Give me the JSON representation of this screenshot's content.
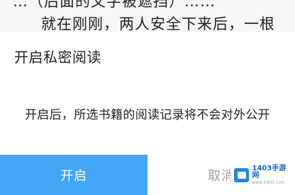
{
  "background": {
    "line_1": "…（后面的文字被遮挡）……",
    "line_2": "就在刚刚，两人安全下来后，一根"
  },
  "dialog": {
    "title": "开启私密阅读",
    "message": "开启后，所选书籍的阅读记录将不会对外公开",
    "confirm_label": "开启",
    "cancel_label": "取消"
  },
  "watermark": {
    "name": "1403手游网",
    "domain": "www.1403.com"
  },
  "colors": {
    "confirm_bg": "#42a5f5",
    "cancel_text": "#9e9e9e"
  }
}
